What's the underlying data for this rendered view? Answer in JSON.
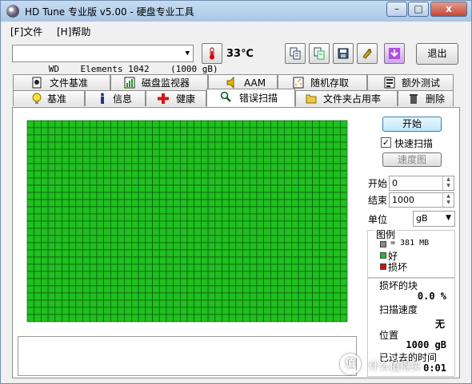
{
  "window": {
    "title": "HD Tune 专业版 v5.00 - 硬盘专业工具",
    "controls": [
      "–",
      "□",
      "x"
    ]
  },
  "menu": {
    "file": "[F]文件",
    "help": "[H]帮助"
  },
  "toolbar": {
    "drive": "WD    Elements 1042    (1000 gB)",
    "temperature": "33℃",
    "exit_label": "退出",
    "buttons": [
      "copy-text-icon",
      "copy-info-icon",
      "save-icon",
      "options-icon",
      "download-icon"
    ]
  },
  "tabs_row1": [
    {
      "label": "文件基准",
      "icon": "file-benchmark-icon"
    },
    {
      "label": "磁盘监视器",
      "icon": "disk-monitor-icon"
    },
    {
      "label": "AAM",
      "icon": "speaker-icon"
    },
    {
      "label": "随机存取",
      "icon": "random-access-icon"
    },
    {
      "label": "额外测试",
      "icon": "extra-tests-icon"
    }
  ],
  "tabs_row2": [
    {
      "label": "基准",
      "icon": "bulb-icon"
    },
    {
      "label": "信息",
      "icon": "info-icon"
    },
    {
      "label": "健康",
      "icon": "health-cross-icon"
    },
    {
      "label": "错误扫描",
      "icon": "magnifier-icon"
    },
    {
      "label": "文件夹占用率",
      "icon": "folder-icon"
    },
    {
      "label": "删除",
      "icon": "trash-icon"
    }
  ],
  "scan": {
    "start_button": "开始",
    "quick_scan_label": "快速扫描",
    "quick_scan_checked": true,
    "speed_map_button": "速度图",
    "start_label": "开始",
    "start_value": "0",
    "end_label": "结束",
    "end_value": "1000",
    "unit_label": "单位",
    "unit_value": "gB",
    "legend_title": "图例",
    "legend_block": "= 381 MB",
    "legend_good": "好",
    "legend_bad": "损坏",
    "damaged_blocks_label": "损坏的块",
    "damaged_blocks_value": "0.0 %",
    "scan_speed_label": "扫描速度",
    "scan_speed_value": "无",
    "position_label": "位置",
    "position_value": "1000 gB",
    "elapsed_label": "已过去的时间",
    "elapsed_value": "0:01"
  },
  "grid": {
    "cols": 46,
    "rows": 28,
    "good_color": "#1fc01f",
    "line_color": "#0b4a0b"
  },
  "colors": {
    "good": "#1fc01f",
    "bad": "#cc1111",
    "block": "#888888"
  },
  "watermark": {
    "logo": "值",
    "text": "什么值得买"
  }
}
